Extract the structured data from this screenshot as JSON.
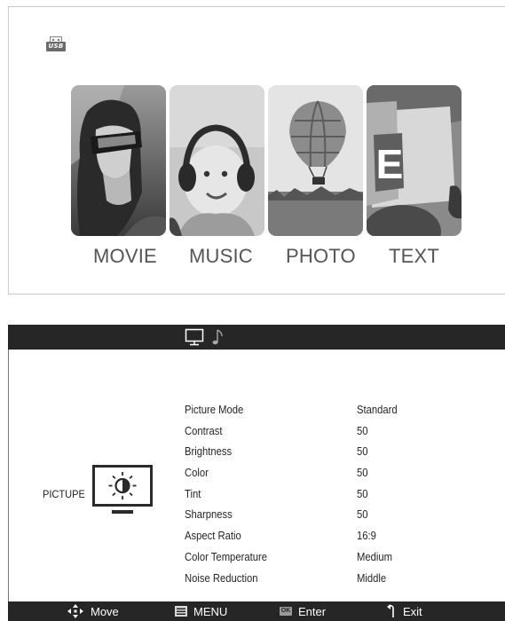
{
  "usb": {
    "icon": "usb-icon",
    "icon_text": "USB"
  },
  "media_menu": {
    "items": [
      {
        "label": "MOVIE",
        "icon": "movie-thumbnail"
      },
      {
        "label": "MUSIC",
        "icon": "music-thumbnail"
      },
      {
        "label": "PHOTO",
        "icon": "photo-thumbnail"
      },
      {
        "label": "TEXT",
        "icon": "text-thumbnail",
        "thumbnail_letter": "E"
      }
    ]
  },
  "osd": {
    "tabs": [
      {
        "icon": "monitor-icon",
        "selected": true
      },
      {
        "icon": "music-note-icon",
        "selected": false
      }
    ],
    "section": {
      "label": "PICTUPE",
      "icon": "brightness-monitor-icon"
    },
    "settings": [
      {
        "label": "Picture Mode",
        "value": "Standard"
      },
      {
        "label": "Contrast",
        "value": "50"
      },
      {
        "label": "Brightness",
        "value": "50"
      },
      {
        "label": "Color",
        "value": "50"
      },
      {
        "label": "Tint",
        "value": "50"
      },
      {
        "label": "Sharpness",
        "value": "50"
      },
      {
        "label": "Aspect Ratio",
        "value": "16:9"
      },
      {
        "label": "Color Temperature",
        "value": "Medium"
      },
      {
        "label": "Noise Reduction",
        "value": "Middle"
      }
    ],
    "footer": [
      {
        "icon": "move-arrows-icon",
        "label": "Move"
      },
      {
        "icon": "menu-icon",
        "label": "MENU"
      },
      {
        "icon": "ok-icon",
        "icon_text": "OK",
        "label": "Enter"
      },
      {
        "icon": "exit-icon",
        "label": "Exit"
      }
    ]
  },
  "colors": {
    "osd_bar": "#262626",
    "panel_border": "#c9c9c9",
    "label_gray": "#555555"
  }
}
